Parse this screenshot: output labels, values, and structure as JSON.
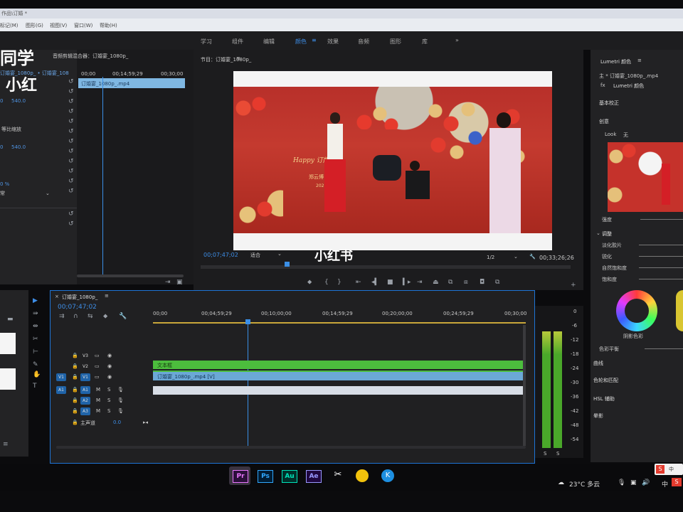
{
  "titlebar": {
    "title": "作品\\订婚 *"
  },
  "menu": {
    "items": [
      "标记(M)",
      "图形(G)",
      "视图(V)",
      "窗口(W)",
      "帮助(H)"
    ]
  },
  "workspaces": [
    "学习",
    "组件",
    "编辑",
    "颜色",
    "效果",
    "音频",
    "图形",
    "库"
  ],
  "workspace_more": "»",
  "watermark": {
    "line1": "同学",
    "line2": "小红",
    "center": "小红书"
  },
  "left_panel": {
    "source_tab": "订婚宴_1080p_ • 订婚宴_108",
    "values": [
      "0",
      "540.0",
      "0",
      "540.0"
    ],
    "label_ratio": "等比缩放",
    "percent": "0 %",
    "dropdown": "常"
  },
  "audio_mixer": {
    "title": "音频剪辑混合器：订婚宴_1080p_",
    "ticks": [
      "00;00",
      "00;14;59;29",
      "00;30;00"
    ],
    "clip": "订婚宴_1080p_.mp4"
  },
  "program": {
    "title": "节目：订婚宴_1080p_",
    "timecode": "00;07;47;02",
    "fit": "适合",
    "ratio": "1/2",
    "duration": "00;33;26;26",
    "video": {
      "backdrop": "Happy 订婚",
      "sign": "郑云博",
      "sign_year": "202"
    }
  },
  "timeline": {
    "title": "订婚宴_1080p_",
    "timecode": "00;07;47;02",
    "ticks": [
      "00;00",
      "00;04;59;29",
      "00;10;00;00",
      "00;14;59;29",
      "00;20;00;00",
      "00;24;59;29",
      "00;30;00"
    ],
    "tracks": [
      {
        "src": "",
        "name": "V3"
      },
      {
        "src": "",
        "name": "V2"
      },
      {
        "src": "V1",
        "name": "V1"
      },
      {
        "src": "A1",
        "name": "A1"
      },
      {
        "src": "",
        "name": "A2"
      },
      {
        "src": "",
        "name": "A3"
      }
    ],
    "mix_label": "主声道",
    "mix_value": "0.0",
    "clip_v2": "文本框",
    "clip_v1": "订婚宴_1080p_.mp4 [V]",
    "track_letters": [
      "M",
      "S"
    ]
  },
  "meter": {
    "labels": [
      "0",
      "-6",
      "-12",
      "-18",
      "-24",
      "-30",
      "-36",
      "-42",
      "-48",
      "-54"
    ],
    "solo": [
      "S",
      "S"
    ]
  },
  "lumetri": {
    "title": "Lumetri 颜色",
    "source": "主 * 订婚宴_1080p_.mp4",
    "clip_name": "订婚宴_1080p_.mp4",
    "fx_label": "fx",
    "fx_name": "Lumetri 颜色",
    "sections": [
      "基本校正",
      "创意"
    ],
    "look_label": "Look",
    "look_value": "无",
    "intensity": "强度",
    "adjust": "调整",
    "sliders": [
      "淡化胶片",
      "锐化",
      "自然饱和度",
      "饱和度"
    ],
    "wheel_label": "阴影色彩",
    "balance": "色彩平衡",
    "more": [
      "曲线",
      "色轮和匹配",
      "HSL 辅助",
      "晕影"
    ]
  },
  "taskbar": {
    "apps": [
      "Pr",
      "Ps",
      "Au",
      "Ae"
    ],
    "weather": "23°C 多云",
    "ime": "中",
    "tray": [
      "S",
      "中"
    ]
  },
  "colors": {
    "accent": "#1e74d6",
    "playhead": "#3b8fe6",
    "clip_green": "#4cbd3d",
    "clip_blue": "#6ba8d6",
    "meter_green": "#4aa82a"
  }
}
